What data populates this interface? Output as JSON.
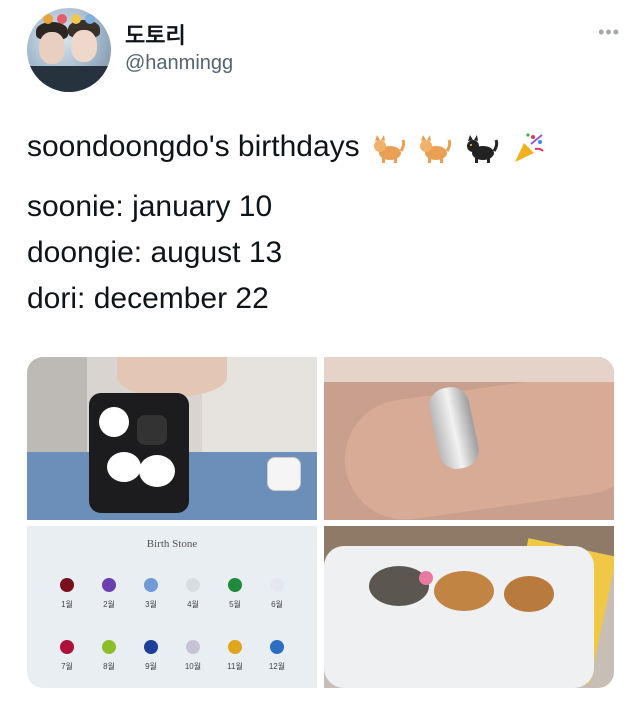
{
  "user": {
    "display_name": "도토리",
    "handle": "@hanmingg"
  },
  "menu": {
    "more_icon": "more-horizontal-icon",
    "more_glyph": "•••"
  },
  "tweet": {
    "title_line": "soondoongdo's birthdays",
    "lines": [
      "soonie: january 10",
      "doongie: august 13",
      "dori: december 22"
    ],
    "emojis": [
      "cat-icon",
      "cat-icon",
      "black-cat-icon",
      "party-popper-icon"
    ]
  },
  "media": {
    "birth_stone_title": "Birth Stone",
    "months_row1": [
      "1월",
      "2월",
      "3월",
      "4월",
      "5월",
      "6월"
    ],
    "months_row2": [
      "7월",
      "8월",
      "9월",
      "10월",
      "11월",
      "12월"
    ],
    "stone_colors_row1": [
      "#7a0f1c",
      "#6b3fb0",
      "#6f9bd6",
      "#d8dde3",
      "#1f8a3c",
      "#e6e6ef"
    ],
    "stone_colors_row2": [
      "#b1103a",
      "#8bbf2a",
      "#1d3f9a",
      "#c8c2d6",
      "#e0a51a",
      "#2a6fc2"
    ]
  }
}
